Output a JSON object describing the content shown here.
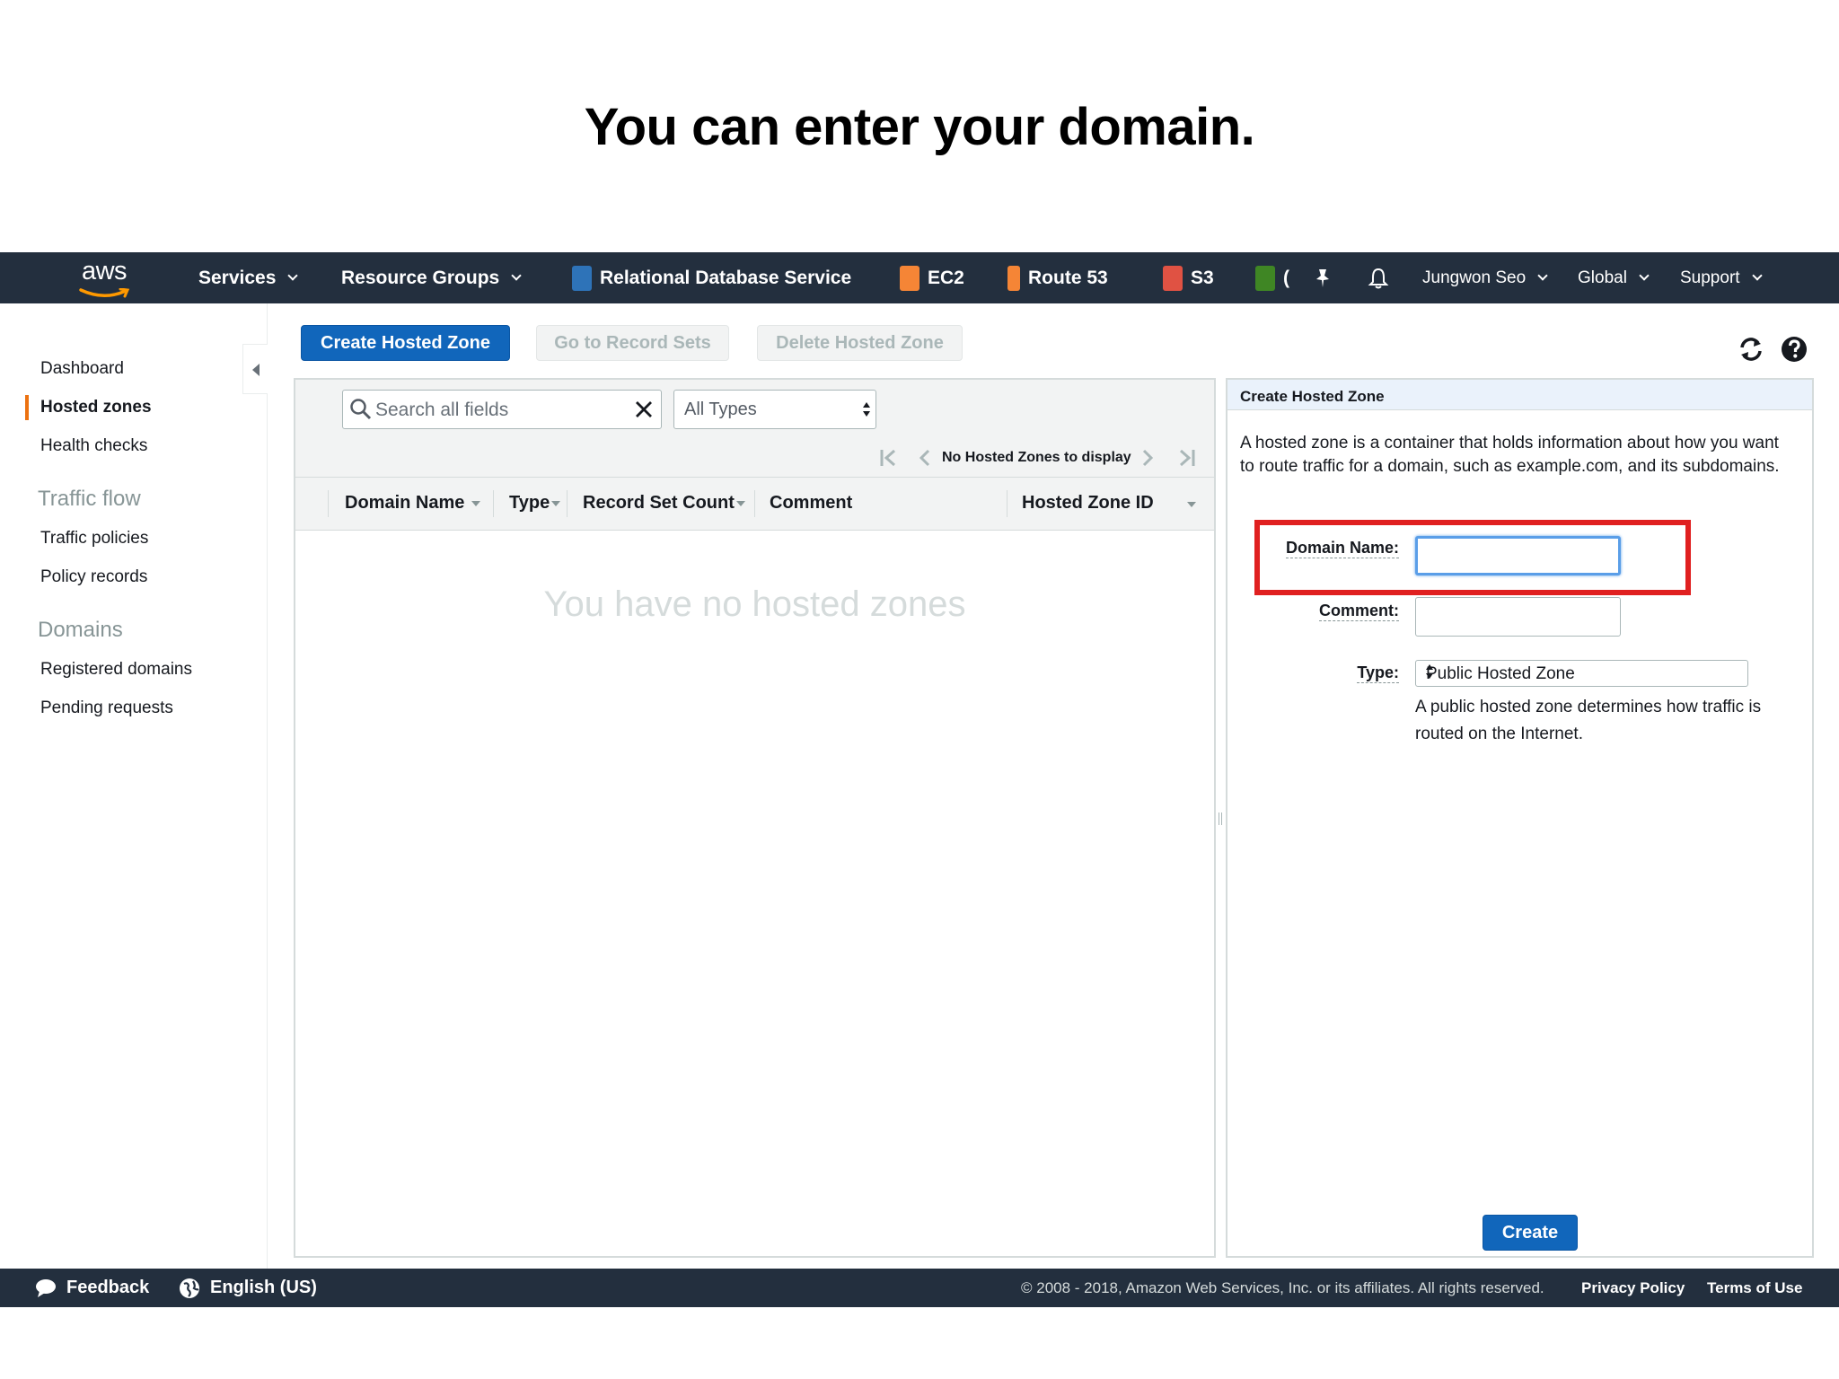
{
  "slide": {
    "title": "You can enter your domain."
  },
  "navbar": {
    "logo_text": "aws",
    "services": "Services",
    "resource_groups": "Resource Groups",
    "shortcuts": [
      {
        "label": "Relational Database Service",
        "icon": "rds-icon",
        "color": "#2e73b8"
      },
      {
        "label": "EC2",
        "icon": "ec2-icon",
        "color": "#f58536"
      },
      {
        "label": "Route 53",
        "icon": "route53-icon",
        "color": "#f58536"
      },
      {
        "label": "S3",
        "icon": "s3-icon",
        "color": "#e05243"
      },
      {
        "label": "(",
        "icon": "dynamodb-icon",
        "color": "#3f8624"
      }
    ],
    "user": "Jungwon Seo",
    "region": "Global",
    "support": "Support"
  },
  "sidebar": {
    "items": {
      "dashboard": "Dashboard",
      "hosted_zones": "Hosted zones",
      "health_checks": "Health checks",
      "traffic_flow_header": "Traffic flow",
      "traffic_policies": "Traffic policies",
      "policy_records": "Policy records",
      "domains_header": "Domains",
      "registered_domains": "Registered domains",
      "pending_requests": "Pending requests"
    },
    "active": "Hosted zones",
    "accent_color": "#ec7211"
  },
  "toolbar": {
    "create_hosted_zone": "Create Hosted Zone",
    "go_to_record_sets": "Go to Record Sets",
    "delete_hosted_zone": "Delete Hosted Zone"
  },
  "table": {
    "search_placeholder": "Search all fields",
    "type_filter": "All Types",
    "pager_text": "No Hosted Zones to display",
    "columns": [
      "Domain Name",
      "Type",
      "Record Set Count",
      "Comment",
      "Hosted Zone ID"
    ],
    "empty_message": "You have no hosted zones"
  },
  "create_panel": {
    "title": "Create Hosted Zone",
    "description": "A hosted zone is a container that holds information about how you want to route traffic for a domain, such as example.com, and its subdomains.",
    "domain_name_label": "Domain Name:",
    "domain_name_value": "",
    "comment_label": "Comment:",
    "comment_value": "",
    "type_label": "Type:",
    "type_value": "Public Hosted Zone",
    "type_help": "A public hosted zone determines how traffic is routed on the Internet.",
    "create_button": "Create",
    "highlight_color": "#e02020"
  },
  "footer": {
    "feedback": "Feedback",
    "language": "English (US)",
    "copyright": "© 2008 - 2018, Amazon Web Services, Inc. or its affiliates. All rights reserved.",
    "privacy": "Privacy Policy",
    "terms": "Terms of Use"
  }
}
